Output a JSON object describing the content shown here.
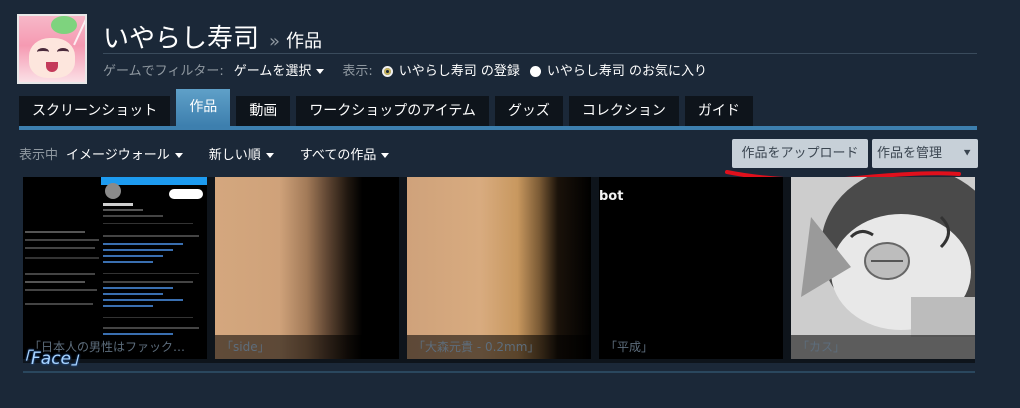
{
  "profile": {
    "name": "いやらし寿司",
    "breadcrumb_sep": "»",
    "breadcrumb_current": "作品"
  },
  "filter": {
    "label": "ゲームでフィルター:",
    "game_select": "ゲームを選択",
    "display_label": "表示:",
    "option_registered": "いやらし寿司 の登録",
    "option_favorites": "いやらし寿司 のお気に入り"
  },
  "tabs": [
    {
      "label": "スクリーンショット",
      "active": false
    },
    {
      "label": "作品",
      "active": true
    },
    {
      "label": "動画",
      "active": false
    },
    {
      "label": "ワークショップのアイテム",
      "active": false
    },
    {
      "label": "グッズ",
      "active": false
    },
    {
      "label": "コレクション",
      "active": false
    },
    {
      "label": "ガイド",
      "active": false
    }
  ],
  "viewbar": {
    "showing_label": "表示中",
    "view_mode": "イメージウォール",
    "sort": "新しい順",
    "scope": "すべての作品",
    "upload_button": "作品をアップロード",
    "manage_button": "作品を管理",
    "manage_icon": "double-chevron-down-icon"
  },
  "cards": [
    {
      "caption": "「日本人の男性はファック…"
    },
    {
      "caption": "「side」"
    },
    {
      "caption": "「大森元貴 - 0.2mm」"
    },
    {
      "caption": "「平成」"
    },
    {
      "caption": "「カス」"
    }
  ],
  "card_overlay": {
    "bot_text": "bot",
    "face_label": "「Face」"
  },
  "colors": {
    "background": "#1b2838",
    "accent": "#3d7fae",
    "annotation_red": "#e0101c"
  }
}
